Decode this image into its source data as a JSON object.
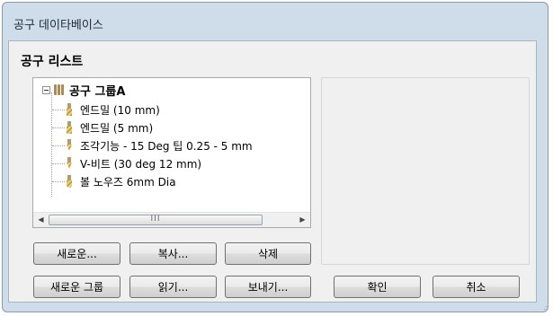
{
  "window": {
    "title": "공구 데이타베이스"
  },
  "section": {
    "title": "공구 리스트"
  },
  "tree": {
    "group_label": "공구 그룹A",
    "items": [
      {
        "label": "엔드밀 (10 mm)",
        "icon": "flat-endmill-icon"
      },
      {
        "label": "엔드밀 (5 mm)",
        "icon": "flat-endmill-icon"
      },
      {
        "label": "조각기능 - 15 Deg 팁 0.25 - 5 mm",
        "icon": "engraving-tool-icon"
      },
      {
        "label": "V-비트 (30 deg 12 mm)",
        "icon": "v-bit-icon"
      },
      {
        "label": "볼 노우즈 6mm Dia",
        "icon": "ball-nose-icon"
      }
    ],
    "scroll_thumb_grip": "III"
  },
  "buttons": {
    "new": "새로운...",
    "copy": "복사...",
    "delete": "삭제",
    "new_group": "새로운 그룹",
    "read": "읽기...",
    "export": "보내기...",
    "ok": "확인",
    "cancel": "취소"
  },
  "colors": {
    "window_frame": "#cfdcea",
    "client": "#f0f0f0",
    "tool_gold": "#c79a34"
  }
}
